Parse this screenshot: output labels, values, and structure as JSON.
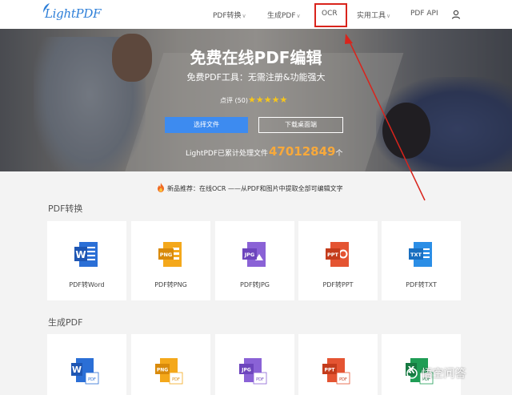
{
  "header": {
    "logo": "LightPDF",
    "nav": [
      {
        "label": "PDF转换",
        "has_dropdown": true
      },
      {
        "label": "生成PDF",
        "has_dropdown": true
      },
      {
        "label": "OCR",
        "has_dropdown": false,
        "highlighted": true
      },
      {
        "label": "实用工具",
        "has_dropdown": true
      },
      {
        "label": "PDF API",
        "has_dropdown": false
      }
    ],
    "user_icon": "user-icon"
  },
  "hero": {
    "title": "免费在线PDF编辑",
    "subtitle": "免费PDF工具：无需注册&功能强大",
    "rating_text": "点评 (50)",
    "stars": 5,
    "select_button": "选择文件",
    "download_button": "下载桌面端",
    "processed_prefix": "LightPDF已累计处理文件",
    "processed_count": "47012849",
    "processed_suffix": "个"
  },
  "announcement": "新品推荐：在线OCR ——从PDF和图片中提取全部可编辑文字",
  "sections": [
    {
      "title": "PDF转换",
      "tools": [
        {
          "label": "PDF转Word",
          "icon_text": "W",
          "color": "#2b6fd6"
        },
        {
          "label": "PDF转PNG",
          "icon_text": "PNG",
          "color": "#f4a81b"
        },
        {
          "label": "PDF转JPG",
          "icon_text": "JPG",
          "color": "#8a62d6"
        },
        {
          "label": "PDF转PPT",
          "icon_text": "PPT",
          "color": "#e45432"
        },
        {
          "label": "PDF转TXT",
          "icon_text": "TXT",
          "color": "#2b8ee6"
        }
      ]
    },
    {
      "title": "生成PDF",
      "tools": [
        {
          "icon_text": "W",
          "badge": "PDF",
          "color": "#2b6fd6"
        },
        {
          "icon_text": "PNG",
          "badge": "PDF",
          "color": "#f4a81b"
        },
        {
          "icon_text": "JPG",
          "badge": "PDF",
          "color": "#8a62d6"
        },
        {
          "icon_text": "PPT",
          "badge": "PDF",
          "color": "#e45432"
        },
        {
          "icon_text": "X",
          "badge": "PDF",
          "color": "#1f9d55"
        }
      ]
    }
  ],
  "watermark": "悟空问答",
  "colors": {
    "brand": "#2e7fd8",
    "primary_button": "#3d8bf0",
    "highlight_box": "#d9241c",
    "count": "#f8a93b",
    "stars": "#f7c61a"
  }
}
